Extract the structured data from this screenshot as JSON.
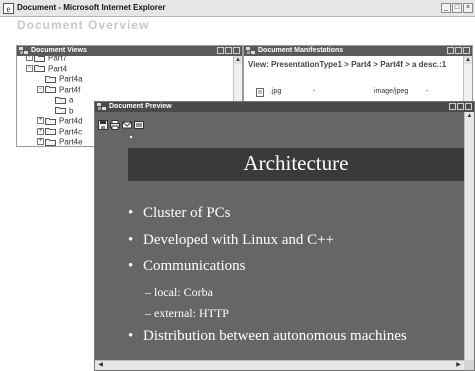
{
  "window": {
    "title": "Document - Microsoft Internet Explorer",
    "min_label": "_",
    "max_label": "□",
    "close_label": "×"
  },
  "page": {
    "heading": "Document Overview"
  },
  "document_views": {
    "title": "Document Views",
    "items": [
      {
        "label": "Part7",
        "expander": "+",
        "level": 1
      },
      {
        "label": "Part4",
        "expander": "−",
        "level": 1
      },
      {
        "label": "Part4a",
        "expander": "",
        "level": 2
      },
      {
        "label": "Part4f",
        "expander": "−",
        "level": 2
      },
      {
        "label": "a",
        "expander": "",
        "level": 3
      },
      {
        "label": "b",
        "expander": "",
        "level": 3
      },
      {
        "label": "Part4d",
        "expander": "+",
        "level": 2
      },
      {
        "label": "Part4c",
        "expander": "+",
        "level": 2
      },
      {
        "label": "Part4e",
        "expander": "+",
        "level": 2
      }
    ]
  },
  "manifestations": {
    "title": "Document Manifestations",
    "breadcrumb": "View: PresentationType1 > Part4 > Part4f > a desc.:1",
    "row": {
      "name": ".jpg",
      "col2": "-",
      "mime": "image/jpeg",
      "col4": "-"
    }
  },
  "preview": {
    "title": "Document Preview",
    "toolbar": [
      "save-icon",
      "print-icon",
      "mail-icon",
      "copy-icon"
    ],
    "slide_title": "Architecture",
    "bullets": [
      "Cluster of PCs",
      "Developed with Linux and C++",
      "Communications",
      "Distribution between autonomous machines"
    ],
    "sub_bullets": [
      "– local: Corba",
      "– external:  HTTP"
    ]
  },
  "colors": {
    "slide_bg": "#666666",
    "title_bar": "#3a3a3a",
    "panel_header": "#5a5a5a"
  }
}
